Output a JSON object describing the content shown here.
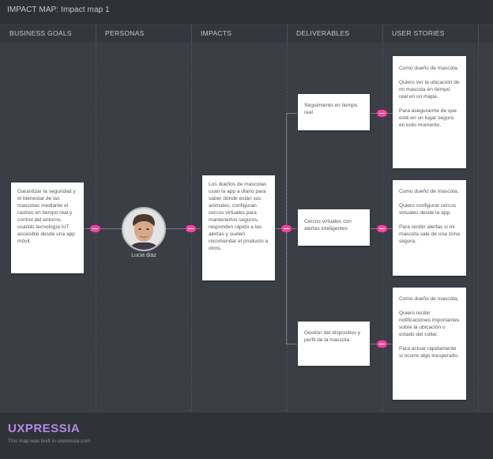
{
  "header": {
    "title": "IMPACT MAP:  Impact map 1"
  },
  "columns": [
    "BUSINESS GOALS",
    "PERSONAS",
    "IMPACTS",
    "DELIVERABLES",
    "USER STORIES"
  ],
  "goal": {
    "text": "Garantizar la seguridad y el bienestar de las mascotas mediante el rastreo en tiempo real y control del entorno, usando tecnología IoT accesible desde una app móvil."
  },
  "persona": {
    "name": "Lucia diaz",
    "icon": "person-portrait"
  },
  "impact": {
    "text": "Los dueños de mascotas usan la app a diario para saber dónde están sus animales, configuran cercos virtuales para mantenerlos seguros, responden rápido a las alertas y suelen recomendar el producto a otros."
  },
  "deliverables": [
    {
      "label": "Seguimiento en tiempo real"
    },
    {
      "label": "Cercos virtuales con alertas inteligentes"
    },
    {
      "label": "Gestión del dispositivo y perfil de la mascota"
    }
  ],
  "stories": [
    {
      "as": "Como dueño de mascota,",
      "want": "Quiero ver la ubicación de mi mascota en tiempo real en un mapa.",
      "so": "Para asegurarme de que esté en un lugar seguro en todo momento."
    },
    {
      "as": "Como dueño de mascota,",
      "want": "Quiero configurar cercos virtuales desde la app.",
      "so": "Para recibir alertas si mi mascota sale de una zona segura."
    },
    {
      "as": "Como dueño de mascota,",
      "want": "Quiero recibir notificaciones importantes sobre la ubicación o estado del collar.",
      "so": "Para actuar rápidamente si ocurre algo inesperado."
    }
  ],
  "footer": {
    "logo": "UXPRESSIA",
    "note": "This map was built in uxpressia.com"
  },
  "colors": {
    "accent": "#ff3fa0",
    "logo": "#b28be8",
    "background": "#3b3e45"
  }
}
